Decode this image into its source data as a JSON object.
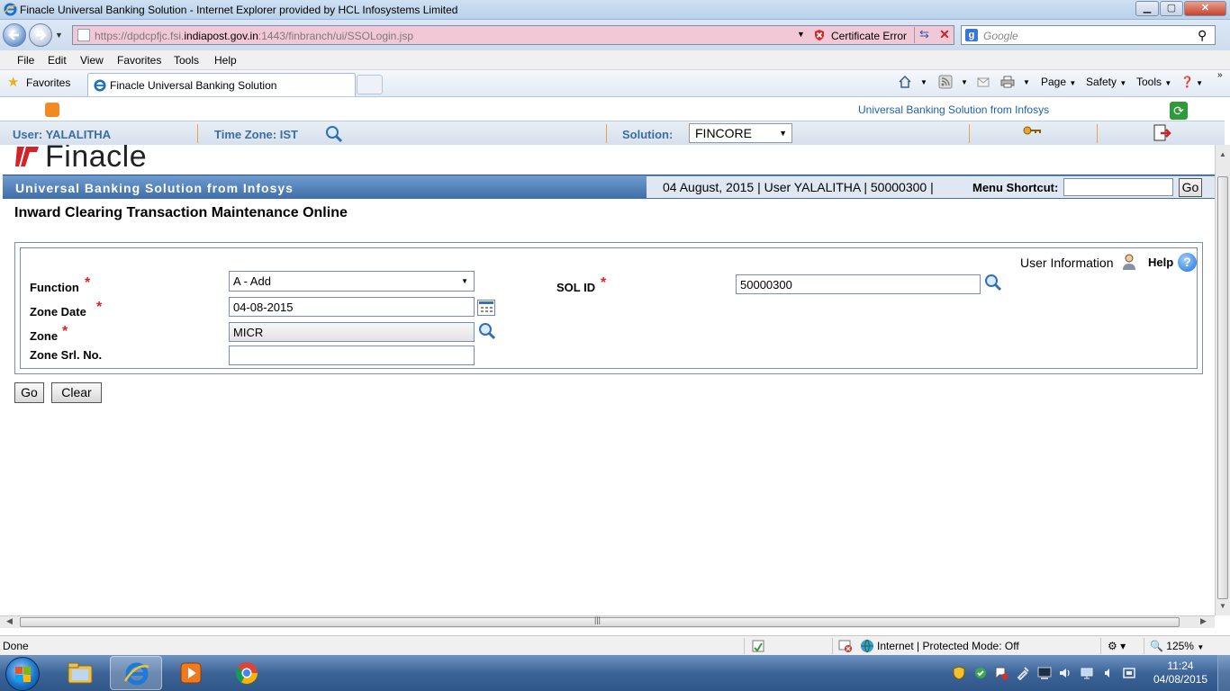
{
  "browser": {
    "window_title": "Finacle Universal Banking Solution - Internet Explorer provided by HCL Infosystems Limited",
    "url_prefix": "https://dpdcpfjc.fsi.",
    "url_domain": "indiapost.gov.in",
    "url_suffix": ":1443/finbranch/ui/SSOLogin.jsp",
    "certificate_error": "Certificate Error",
    "search_placeholder": "Google",
    "menu": [
      "File",
      "Edit",
      "View",
      "Favorites",
      "Tools",
      "Help"
    ],
    "favorites_label": "Favorites",
    "tab_title": "Finacle Universal Banking Solution",
    "commands": {
      "page": "Page",
      "safety": "Safety",
      "tools": "Tools"
    }
  },
  "finacle_header": {
    "brand_link": "Universal Banking Solution from Infosys",
    "user_label": "User: YALALITHA",
    "timezone_label": "Time Zone:  IST",
    "solution_label": "Solution:",
    "solution_value": "FINCORE"
  },
  "app": {
    "logo_text": "Finacle",
    "band_title": "Universal Banking Solution from Infosys",
    "info_text": "04 August, 2015  |  User  YALALITHA  |  50000300  |",
    "menu_shortcut_label": "Menu Shortcut:",
    "menu_shortcut_value": "",
    "go_label": "Go",
    "page_heading": "Inward Clearing Transaction Maintenance  Online"
  },
  "form": {
    "user_information": "User Information",
    "help": "Help",
    "function_label": "Function",
    "function_value": "A - Add",
    "zone_date_label": "Zone Date",
    "zone_date_value": "04-08-2015",
    "zone_label": "Zone",
    "zone_value": "MICR",
    "zone_srl_label": "Zone Srl. No.",
    "zone_srl_value": "",
    "sol_id_label": "SOL ID",
    "sol_id_value": "50000300",
    "required_mark": "*",
    "go_button": "Go",
    "clear_button": "Clear"
  },
  "statusbar": {
    "status": "Done",
    "zone": "Internet | Protected Mode: Off",
    "zoom": "125%"
  },
  "taskbar": {
    "time": "11:24",
    "date": "04/08/2015"
  }
}
